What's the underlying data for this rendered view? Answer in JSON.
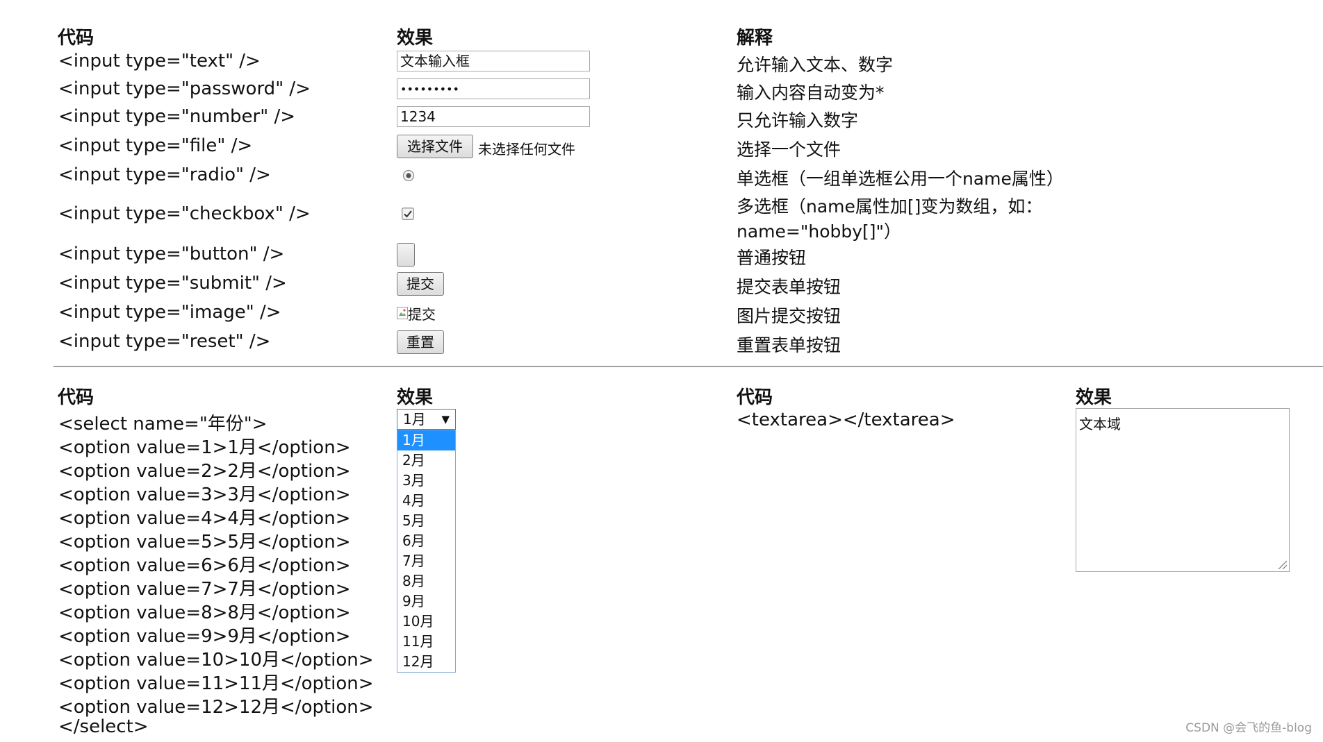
{
  "top_section": {
    "headers": {
      "code": "代码",
      "effect": "效果",
      "explain": "解释"
    },
    "rows": [
      {
        "code": "<input type=\"text\" />",
        "value": "文本输入框",
        "explain": "允许输入文本、数字"
      },
      {
        "code": "<input type=\"password\" />",
        "value": "•••••••••",
        "explain": "输入内容自动变为*"
      },
      {
        "code": "<input type=\"number\" />",
        "value": "1234",
        "explain": "只允许输入数字"
      },
      {
        "code": "<input type=\"file\" />",
        "button": "选择文件",
        "status": "未选择任何文件",
        "explain": "选择一个文件"
      },
      {
        "code": "<input type=\"radio\" />",
        "explain": "单选框（一组单选框公用一个name属性）"
      },
      {
        "code": "<input type=\"checkbox\" />",
        "explain_line1": "多选框（name属性加[]变为数组，如：",
        "explain_line2": "name=\"hobby[]\"）"
      },
      {
        "code": "<input type=\"button\" />",
        "explain": "普通按钮"
      },
      {
        "code": "<input type=\"submit\" />",
        "button": "提交",
        "explain": "提交表单按钮"
      },
      {
        "code": "<input type=\"image\" />",
        "alt": "提交",
        "explain": "图片提交按钮"
      },
      {
        "code": "<input type=\"reset\" />",
        "button": "重置",
        "explain": "重置表单按钮"
      }
    ]
  },
  "bottom_section": {
    "headers": {
      "code": "代码",
      "effect": "效果",
      "code2": "代码",
      "effect2": "效果"
    },
    "select_code": [
      "<select name=\"年份\">",
      "<option value=1>1月</option>",
      "<option value=2>2月</option>",
      "<option value=3>3月</option>",
      "<option value=4>4月</option>",
      "<option value=5>5月</option>",
      "<option value=6>6月</option>",
      "<option value=7>7月</option>",
      "<option value=8>8月</option>",
      "<option value=9>9月</option>",
      "<option value=10>10月</option>",
      "<option value=11>11月</option>",
      "<option value=12>12月</option>",
      "</select>"
    ],
    "select_value": "1月",
    "select_options": [
      "1月",
      "2月",
      "3月",
      "4月",
      "5月",
      "6月",
      "7月",
      "8月",
      "9月",
      "10月",
      "11月",
      "12月"
    ],
    "selected_index": 0,
    "textarea_code": "<textarea></textarea>",
    "textarea_value": "文本域"
  },
  "watermark": "CSDN @会飞的鱼-blog"
}
